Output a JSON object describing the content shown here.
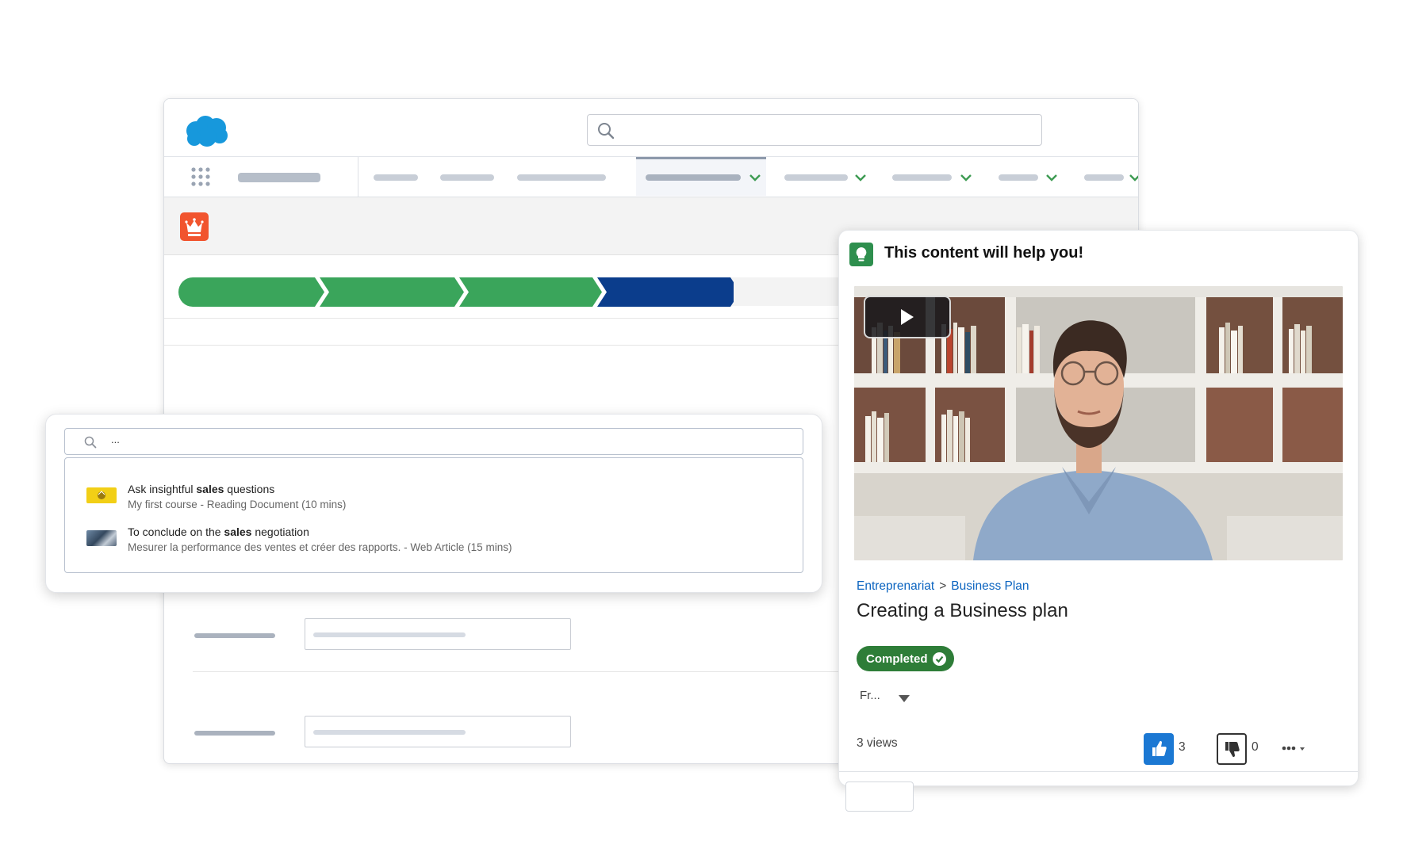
{
  "popup_search": {
    "value": "...",
    "results": [
      {
        "title_before": "Ask insightful ",
        "title_bold": "sales",
        "title_after": " questions",
        "subtitle": "My first course - Reading Document (10 mins)"
      },
      {
        "title_before": "To conclude on the ",
        "title_bold": "sales",
        "title_after": " negotiation",
        "subtitle": "Mesurer la performance des ventes et créer des rapports. - Web Article (15 mins)"
      }
    ]
  },
  "card": {
    "header_title": "This content will help you!",
    "breadcrumb": [
      "Entreprenariat",
      ">",
      "Business Plan"
    ],
    "content_title": "Creating a Business plan",
    "status": "Completed",
    "language": "Fr...",
    "views": "3 views",
    "likes": "3",
    "dislikes": "0"
  },
  "colors": {
    "path_complete": "#3aa55b",
    "path_current": "#0b3d8c",
    "like": "#1b78d3",
    "link": "#0b64c0",
    "completed_badge": "#2e7d38",
    "brand_cloud": "#1798dc",
    "record_icon": "#f1542e"
  },
  "icons": {
    "logo": "cloud-logo",
    "app_launcher": "app-launcher-grid-icon",
    "record": "crown-icon",
    "card": "lightbulb-icon",
    "play": "play-icon",
    "like": "thumbs-up-icon",
    "dislike": "thumbs-down-icon"
  }
}
